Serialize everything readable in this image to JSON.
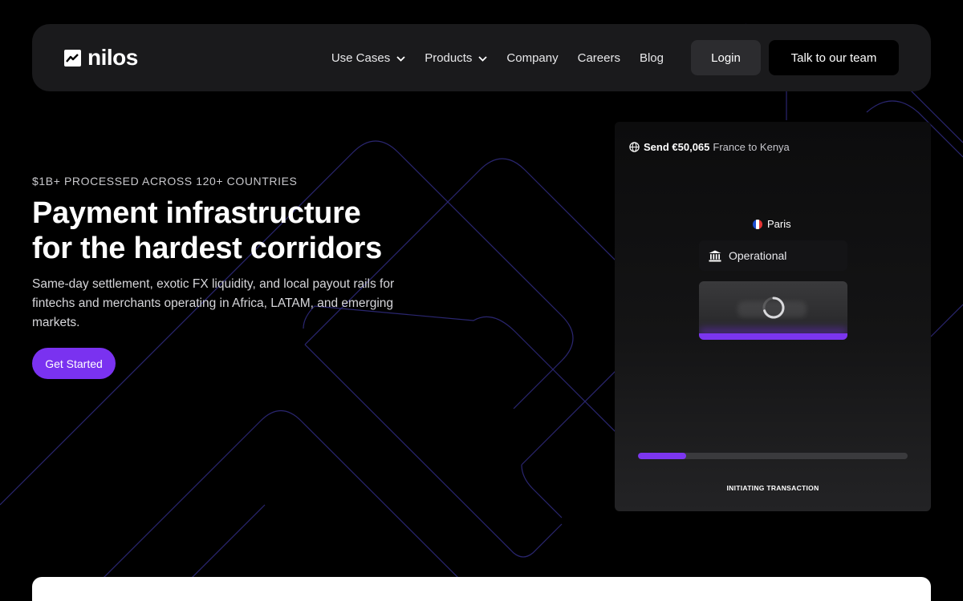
{
  "brand": {
    "name": "nilos",
    "logo_icon": "chart-trend-icon"
  },
  "nav": {
    "links": [
      {
        "label": "Use Cases",
        "dropdown": true
      },
      {
        "label": "Products",
        "dropdown": true
      },
      {
        "label": "Company",
        "dropdown": false
      },
      {
        "label": "Careers",
        "dropdown": false
      },
      {
        "label": "Blog",
        "dropdown": false
      }
    ],
    "login_label": "Login",
    "talk_label": "Talk to our team"
  },
  "hero": {
    "eyebrow": "$1B+ PROCESSED ACROSS 120+ COUNTRIES",
    "headline_line1": "Payment infrastructure",
    "headline_line2": "for the hardest corridors",
    "subtext": "Same-day settlement, exotic FX liquidity, and local payout rails for fintechs and merchants operating in Africa, LATAM, and emerging markets.",
    "cta_label": "Get Started"
  },
  "card": {
    "send_label": "Send €50,065",
    "route_label": "France to Kenya",
    "city_label": "Paris",
    "status_label": "Operational",
    "progress": 0.18,
    "progress_label": "INITIATING TRANSACTION"
  },
  "colors": {
    "accent": "#7a32f0",
    "nav_bg": "#1a1a1c",
    "page_bg": "#000000"
  }
}
